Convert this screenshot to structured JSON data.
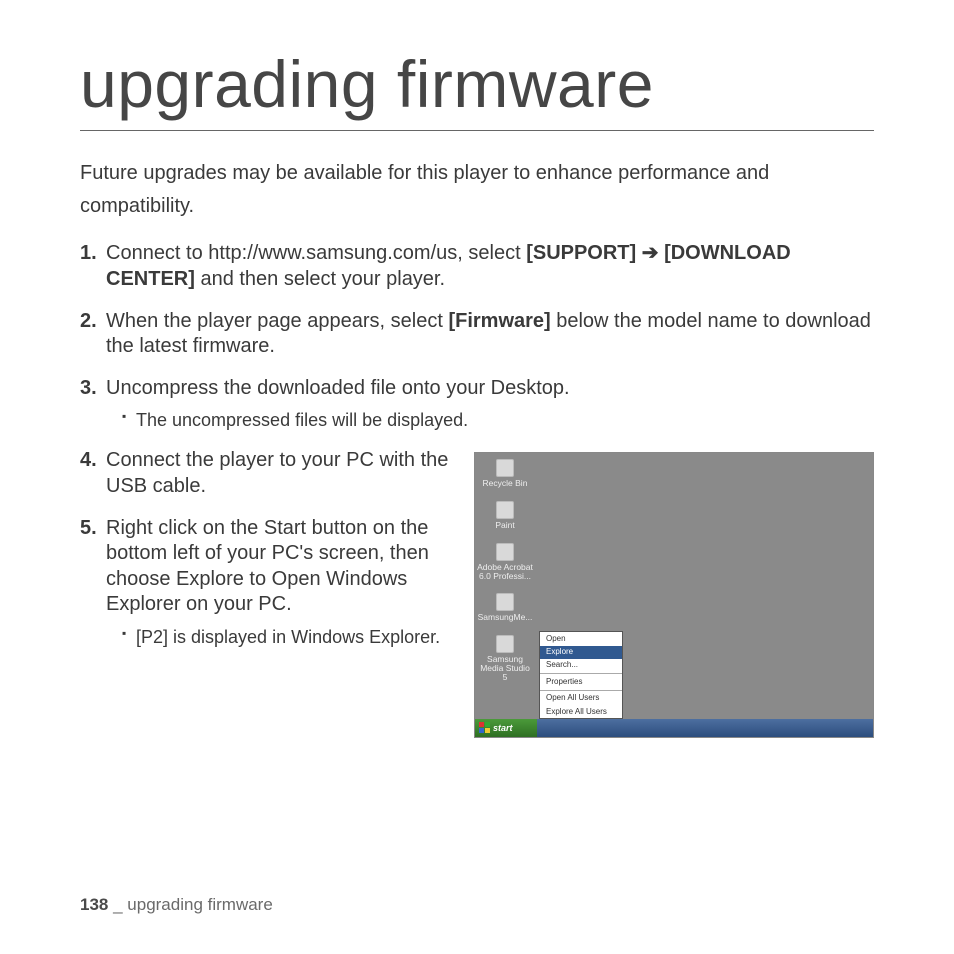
{
  "page_title": "upgrading firmware",
  "intro": "Future upgrades may be available for this player to enhance performance and compatibility.",
  "steps": {
    "s1_pre": "Connect to http://www.samsung.com/us, select ",
    "s1_b1": "[SUPPORT]",
    "s1_arrow": " ➔ ",
    "s1_b2": "[DOWNLOAD CENTER]",
    "s1_post": " and then select your player.",
    "s2_pre": "When the player page appears, select ",
    "s2_b1": "[Firmware]",
    "s2_post": " below the model name to download the latest firmware.",
    "s3": "Uncompress the downloaded file onto your Desktop.",
    "s3_sub": "The uncompressed files will be displayed.",
    "s4": "Connect the player to your PC with the USB cable.",
    "s5": "Right click on the Start button on the bottom left of your PC's screen, then choose Explore to Open Windows Explorer on your PC.",
    "s5_sub": "[P2] is displayed in Windows Explorer."
  },
  "screenshot": {
    "icons": {
      "recycle": "Recycle Bin",
      "paint": "Paint",
      "acrobat": "Adobe Acrobat 6.0 Professi...",
      "sammedia1": "SamsungMe...",
      "sammedia2": "Samsung Media Studio 5"
    },
    "menu": {
      "open": "Open",
      "explore": "Explore",
      "search": "Search...",
      "properties": "Properties",
      "openall": "Open All Users",
      "exploreall": "Explore All Users"
    },
    "start": "start"
  },
  "footer": {
    "page_num": "138",
    "sep": " _ ",
    "section": "upgrading firmware"
  }
}
